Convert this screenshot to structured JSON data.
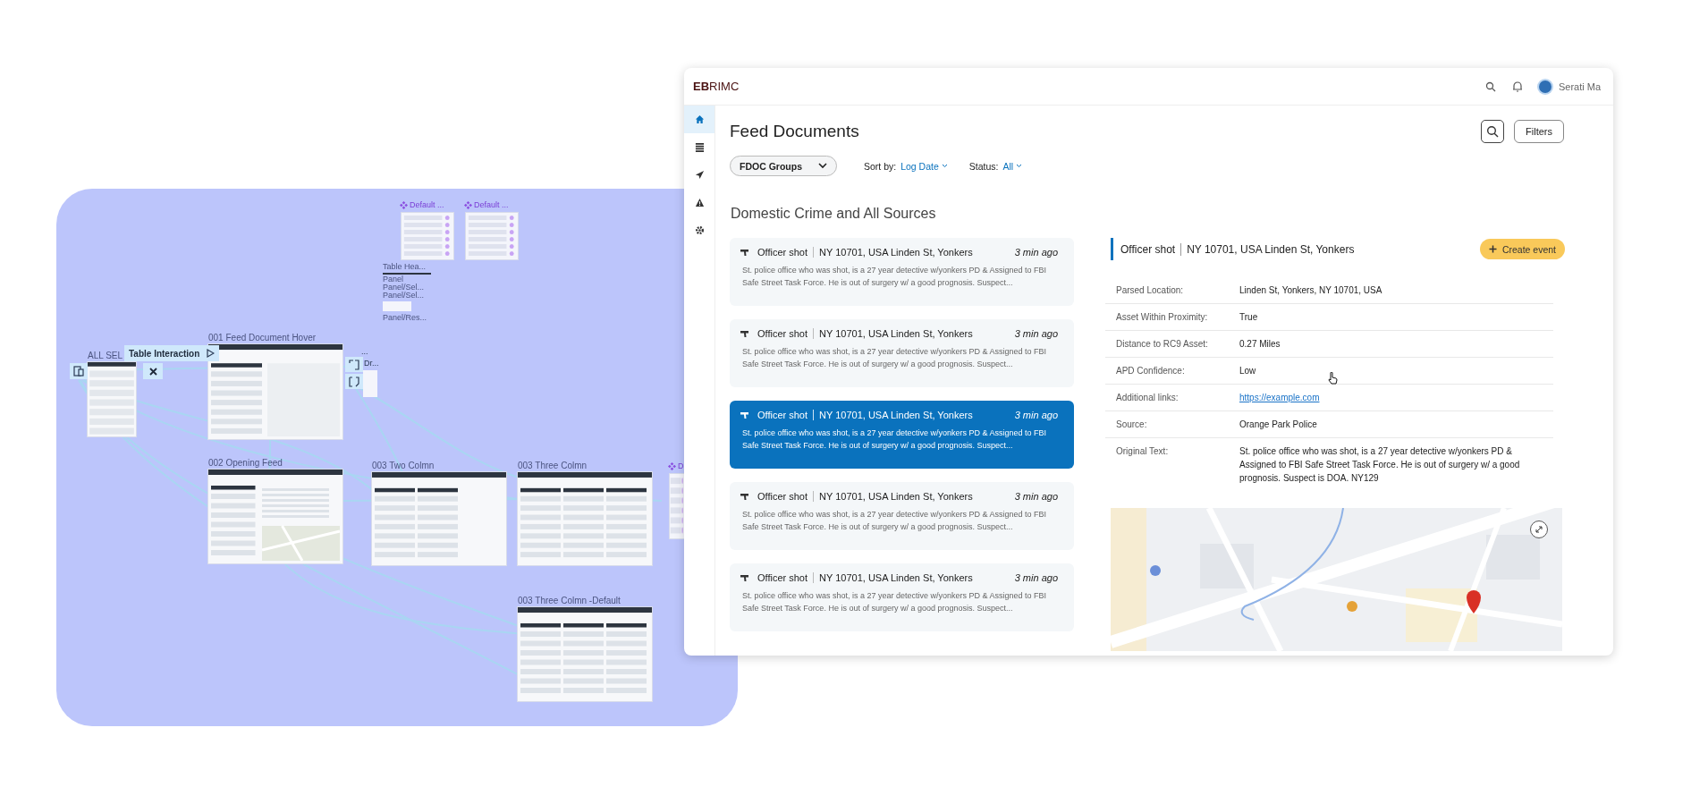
{
  "canvas": {
    "frames": [
      {
        "label": "ALL SEL",
        "kind": "list"
      },
      {
        "label": "001 Feed Document Hover",
        "kind": "hover"
      },
      {
        "label": "002 Opening Feed",
        "kind": "detail"
      },
      {
        "label": "003 Two Colmn",
        "kind": "two-column"
      },
      {
        "label": "003 Three Colmn",
        "kind": "three-column"
      },
      {
        "label": "003 Three Colmn -Default",
        "kind": "three-column"
      }
    ],
    "components": [
      {
        "label": "Default ..."
      },
      {
        "label": "Default ..."
      },
      {
        "label": "D"
      }
    ],
    "panel_labels": [
      "Table Hea...",
      "Panel",
      "Panel/Sel...",
      "Panel/Sel...",
      "Panel/Res..."
    ],
    "interaction": {
      "label": "Table Interaction"
    },
    "side_labels": [
      "...",
      "Dr..."
    ]
  },
  "app": {
    "logo": "**EB**RIMC",
    "user": {
      "name": "Serati Ma"
    },
    "nav": [
      {
        "selected": true
      },
      {
        "selected": false
      },
      {
        "selected": false
      },
      {
        "selected": false
      },
      {
        "selected": false
      }
    ]
  },
  "page": {
    "title": "Feed Documents",
    "filters_button": "Filters",
    "group_select": "FDOC Groups",
    "sort": {
      "label": "Sort by:",
      "value": "Log Date"
    },
    "status": {
      "label": "Status:",
      "value": "All"
    }
  },
  "feed": {
    "title": "Domestic Crime and All Sources",
    "cards": [
      {
        "title": "Officer shot",
        "location": "NY 10701, USA  Linden St, Yonkers",
        "time": "3 min ago",
        "body": "St. police office who was shot, is a 27 year detective w/yonkers PD & Assigned to FBI Safe Street Task Force. He is out of surgery w/ a good prognosis. Suspect...",
        "selected": false
      },
      {
        "title": "Officer shot",
        "location": "NY 10701, USA  Linden St, Yonkers",
        "time": "3 min ago",
        "body": "St. police office who was shot, is a 27 year detective w/yonkers PD & Assigned to FBI Safe Street Task Force. He is out of surgery w/ a good prognosis. Suspect...",
        "selected": false
      },
      {
        "title": "Officer shot",
        "location": "NY 10701, USA  Linden St, Yonkers",
        "time": "3 min ago",
        "body": "St. police office who was shot, is a 27 year detective w/yonkers PD & Assigned to FBI Safe Street Task Force. He is out of surgery w/ a good prognosis. Suspect...",
        "selected": true
      },
      {
        "title": "Officer shot",
        "location": "NY 10701, USA  Linden St, Yonkers",
        "time": "3 min ago",
        "body": "St. police office who was shot, is a 27 year detective w/yonkers PD & Assigned to FBI Safe Street Task Force. He is out of surgery w/ a good prognosis. Suspect...",
        "selected": false
      },
      {
        "title": "Officer shot",
        "location": "NY 10701, USA  Linden St, Yonkers",
        "time": "3 min ago",
        "body": "St. police office who was shot, is a 27 year detective w/yonkers PD & Assigned to FBI Safe Street Task Force. He is out of surgery w/ a good prognosis. Suspect...",
        "selected": false
      }
    ]
  },
  "detail": {
    "title": "Officer shot",
    "location": "NY 10701, USA Linden St, Yonkers",
    "create_button": "Create event",
    "fields": [
      {
        "label": "Parsed Location:",
        "value": "Linden St, Yonkers, NY 10701, USA",
        "kind": "text"
      },
      {
        "label": "Asset Within Proximity:",
        "value": "True",
        "kind": "text"
      },
      {
        "label": "Distance to RC9 Asset:",
        "value": "0.27 Miles",
        "kind": "text"
      },
      {
        "label": "APD Confidence:",
        "value": "Low",
        "kind": "text"
      },
      {
        "label": "Additional links:",
        "value": "https://example.com",
        "kind": "link"
      },
      {
        "label": "Source:",
        "value": "Orange Park Police",
        "kind": "text"
      },
      {
        "label": "Original Text:",
        "value": "St. police office who was shot, is a 27 year detective w/yonkers PD & Assigned to FBI Safe Street Task Force. He is out of surgery w/ a good prognosis. Suspect is DOA. NY129",
        "kind": "text"
      }
    ]
  }
}
